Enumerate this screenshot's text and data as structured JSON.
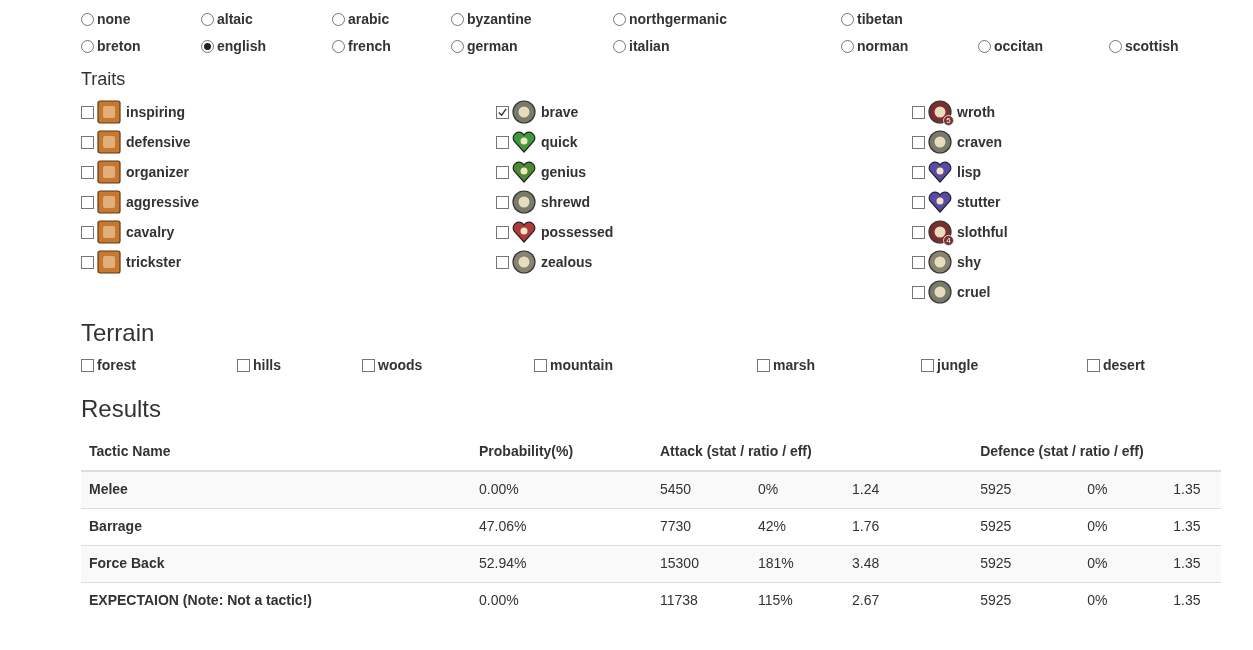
{
  "cultures": [
    [
      {
        "label": "none",
        "selected": false
      },
      {
        "label": "altaic",
        "selected": false
      },
      {
        "label": "arabic",
        "selected": false
      },
      {
        "label": "byzantine",
        "selected": false
      },
      {
        "label": "northgermanic",
        "selected": false
      },
      {
        "label": "tibetan",
        "selected": false
      }
    ],
    [
      {
        "label": "breton",
        "selected": false
      },
      {
        "label": "english",
        "selected": true
      },
      {
        "label": "french",
        "selected": false
      },
      {
        "label": "german",
        "selected": false
      },
      {
        "label": "italian",
        "selected": false
      },
      {
        "label": "norman",
        "selected": false
      },
      {
        "label": "occitan",
        "selected": false
      },
      {
        "label": "scottish",
        "selected": false
      }
    ]
  ],
  "traits": {
    "title": "Traits",
    "columns": [
      [
        {
          "label": "inspiring",
          "checked": false,
          "kind": "square",
          "color": "#c8772e"
        },
        {
          "label": "defensive",
          "checked": false,
          "kind": "square",
          "color": "#c8772e"
        },
        {
          "label": "organizer",
          "checked": false,
          "kind": "square",
          "color": "#c8772e"
        },
        {
          "label": "aggressive",
          "checked": false,
          "kind": "square",
          "color": "#c8772e"
        },
        {
          "label": "cavalry",
          "checked": false,
          "kind": "square",
          "color": "#c8772e"
        },
        {
          "label": "trickster",
          "checked": false,
          "kind": "square",
          "color": "#c8772e"
        }
      ],
      [
        {
          "label": "brave",
          "checked": true,
          "kind": "round",
          "color": "#7a7a6a"
        },
        {
          "label": "quick",
          "checked": false,
          "kind": "heart",
          "color": "#3f9a3a"
        },
        {
          "label": "genius",
          "checked": false,
          "kind": "heart",
          "color": "#4a8a30"
        },
        {
          "label": "shrewd",
          "checked": false,
          "kind": "round",
          "color": "#7a7a6a"
        },
        {
          "label": "possessed",
          "checked": false,
          "kind": "heart",
          "color": "#b03a3a"
        },
        {
          "label": "zealous",
          "checked": false,
          "kind": "round",
          "color": "#8a8270"
        }
      ],
      [
        {
          "label": "wroth",
          "checked": false,
          "kind": "round",
          "color": "#7a2e2e",
          "number": "5"
        },
        {
          "label": "craven",
          "checked": false,
          "kind": "round",
          "color": "#7a7a6a"
        },
        {
          "label": "lisp",
          "checked": false,
          "kind": "heart",
          "color": "#5a4aa8"
        },
        {
          "label": "stutter",
          "checked": false,
          "kind": "heart",
          "color": "#5a4aa8"
        },
        {
          "label": "slothful",
          "checked": false,
          "kind": "round",
          "color": "#7a2e2e",
          "number": "4"
        },
        {
          "label": "shy",
          "checked": false,
          "kind": "round",
          "color": "#8a8270"
        },
        {
          "label": "cruel",
          "checked": false,
          "kind": "round",
          "color": "#7a7a6a"
        }
      ]
    ]
  },
  "terrain": {
    "title": "Terrain",
    "items": [
      {
        "label": "forest",
        "checked": false
      },
      {
        "label": "hills",
        "checked": false
      },
      {
        "label": "woods",
        "checked": false
      },
      {
        "label": "mountain",
        "checked": false
      },
      {
        "label": "marsh",
        "checked": false
      },
      {
        "label": "jungle",
        "checked": false
      },
      {
        "label": "desert",
        "checked": false
      }
    ]
  },
  "results": {
    "title": "Results",
    "columns": [
      "Tactic Name",
      "Probability(%)",
      "Attack (stat / ratio / eff)",
      "Defence (stat / ratio / eff)"
    ],
    "rows": [
      {
        "name": "Melee",
        "probability": "0.00%",
        "attack": [
          "5450",
          "0%",
          "1.24"
        ],
        "defence": [
          "5925",
          "0%",
          "1.35"
        ]
      },
      {
        "name": "Barrage",
        "probability": "47.06%",
        "attack": [
          "7730",
          "42%",
          "1.76"
        ],
        "defence": [
          "5925",
          "0%",
          "1.35"
        ]
      },
      {
        "name": "Force Back",
        "probability": "52.94%",
        "attack": [
          "15300",
          "181%",
          "3.48"
        ],
        "defence": [
          "5925",
          "0%",
          "1.35"
        ]
      },
      {
        "name": "EXPECTAION (Note: Not a tactic!)",
        "probability": "0.00%",
        "attack": [
          "11738",
          "115%",
          "2.67"
        ],
        "defence": [
          "5925",
          "0%",
          "1.35"
        ]
      }
    ]
  }
}
